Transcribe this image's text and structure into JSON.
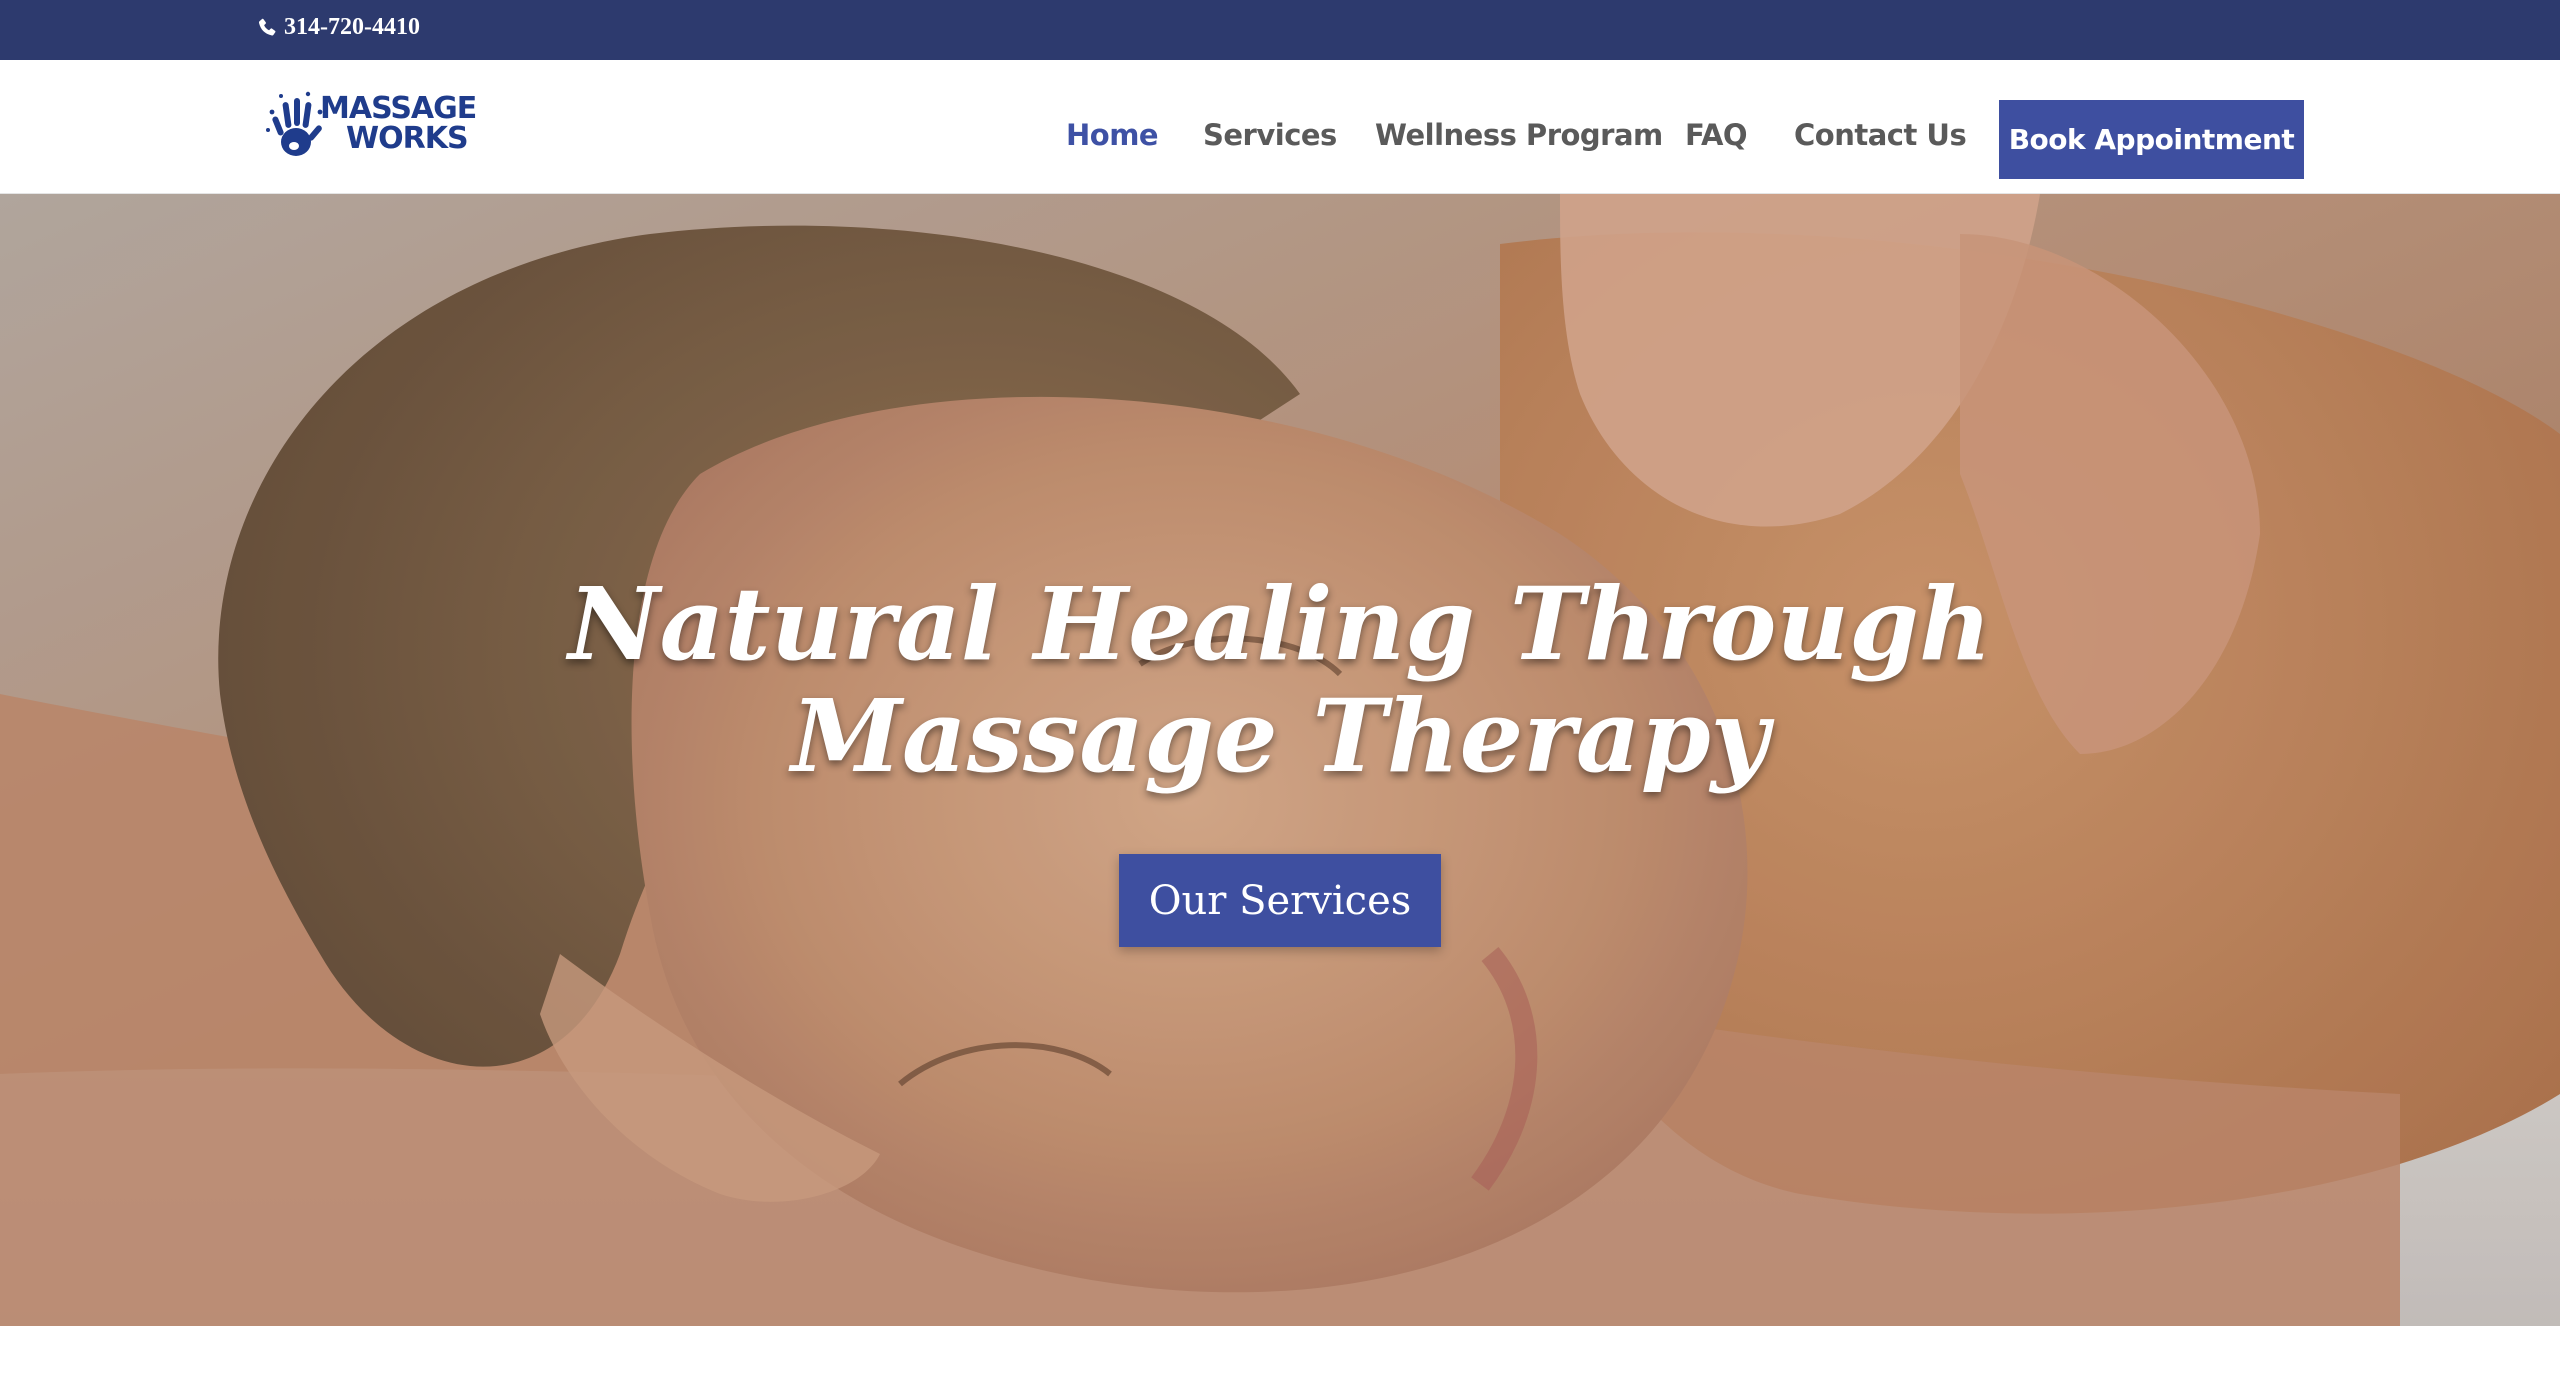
{
  "topbar": {
    "phone": "314-720-4410",
    "phone_icon": "phone-icon",
    "background": "#2d3a6e"
  },
  "header": {
    "logo": {
      "line1": "MASSAGE",
      "line2": "WORKS",
      "icon": "hand-print-icon",
      "color": "#1f3c8c"
    },
    "nav": [
      {
        "label": "Home",
        "active": true
      },
      {
        "label": "Services",
        "active": false
      },
      {
        "label": "Wellness Program",
        "active": false
      },
      {
        "label": "FAQ",
        "active": false
      },
      {
        "label": "Contact Us",
        "active": false
      }
    ],
    "book_button": "Book Appointment",
    "accent": "#3e4fa0"
  },
  "hero": {
    "title": "Natural Healing Through Massage Therapy",
    "cta": "Our Services",
    "background": "photo of a woman relaxing during a shoulder massage"
  }
}
